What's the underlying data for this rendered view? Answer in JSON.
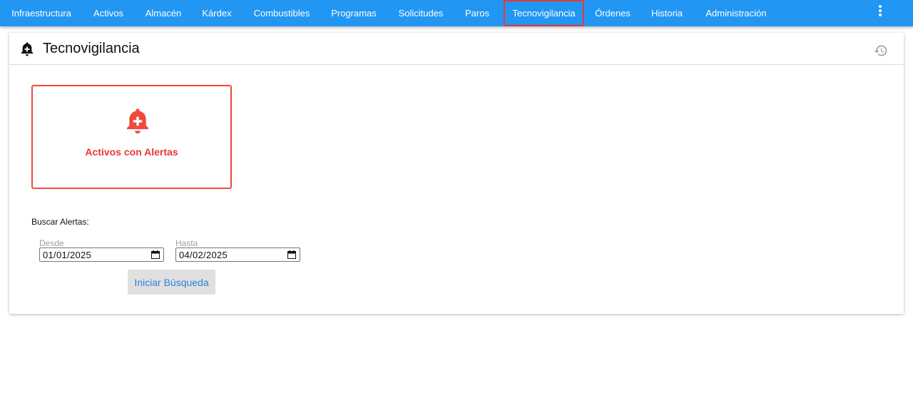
{
  "nav": {
    "items": [
      {
        "label": "Infraestructura"
      },
      {
        "label": "Activos"
      },
      {
        "label": "Almacén"
      },
      {
        "label": "Kárdex"
      },
      {
        "label": "Combustibles"
      },
      {
        "label": "Programas"
      },
      {
        "label": "Solicitudes"
      },
      {
        "label": "Paros"
      },
      {
        "label": "Tecnovigilancia",
        "active": true
      },
      {
        "label": "Órdenes"
      },
      {
        "label": "Historia"
      },
      {
        "label": "Administración"
      }
    ],
    "more_icon": "more-vertical-icon"
  },
  "page": {
    "title": "Tecnovigilancia",
    "title_icon": "bell-plus-icon",
    "history_icon": "history-icon"
  },
  "tile": {
    "label": "Activos con Alertas",
    "icon": "bell-plus-icon"
  },
  "search": {
    "label": "Buscar Alertas:",
    "from_label": "Desde",
    "from_value": "01/01/2025",
    "to_label": "Hasta",
    "to_value": "04/02/2025",
    "button_label": "Iniciar Búsqueda"
  },
  "colors": {
    "nav_bg": "#2196f3",
    "accent_red": "#ef4a3c",
    "button_text": "#2f7fdc"
  }
}
